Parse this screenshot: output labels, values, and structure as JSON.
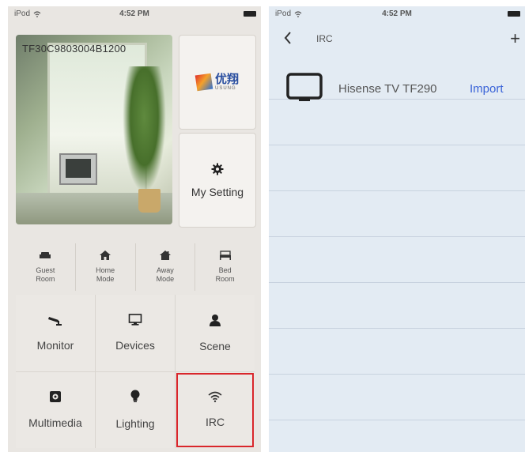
{
  "status_bar": {
    "carrier": "iPod",
    "time": "4:52 PM"
  },
  "home": {
    "device_id": "TF30C9803004B1200",
    "logo": {
      "cn": "优翔",
      "en": "USUNG"
    },
    "settings_tile": {
      "label": "My Setting",
      "icon": "gear-icon"
    },
    "modes": [
      {
        "label": "Guest\nRoom",
        "icon": "sofa-icon"
      },
      {
        "label": "Home\nMode",
        "icon": "home-icon"
      },
      {
        "label": "Away\nMode",
        "icon": "house-away-icon"
      },
      {
        "label": "Bed\nRoom",
        "icon": "bed-icon"
      }
    ],
    "grid": [
      {
        "label": "Monitor",
        "icon": "camera-icon"
      },
      {
        "label": "Devices",
        "icon": "monitor-icon"
      },
      {
        "label": "Scene",
        "icon": "person-icon"
      },
      {
        "label": "Multimedia",
        "icon": "media-icon"
      },
      {
        "label": "Lighting",
        "icon": "bulb-icon"
      },
      {
        "label": "IRC",
        "icon": "wifi-icon",
        "selected": true
      }
    ],
    "highlight_color": "#d9262b"
  },
  "irc": {
    "title": "IRC",
    "add_label": "+",
    "devices": [
      {
        "name": "Hisense TV TF290",
        "action": "Import"
      }
    ],
    "action_color": "#3a63d8"
  }
}
